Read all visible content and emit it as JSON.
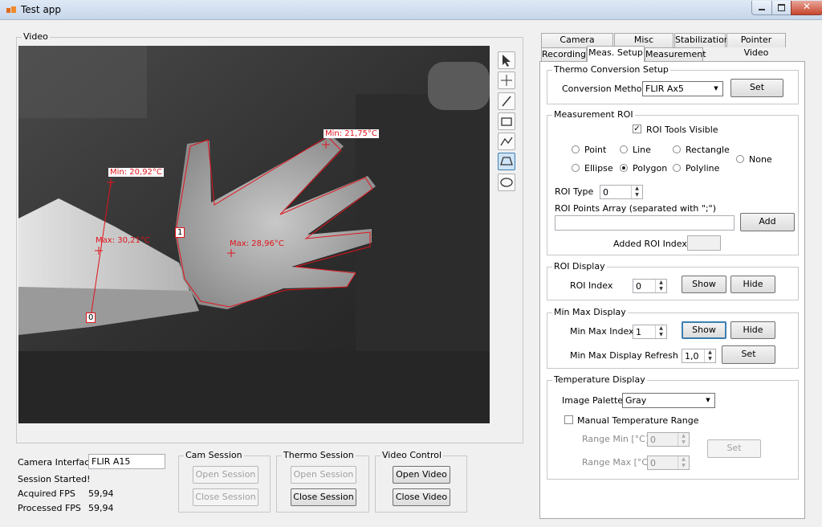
{
  "window": {
    "title": "Test app"
  },
  "video": {
    "group_label": "Video",
    "annotations": {
      "min_left": "Min: 20,92°C",
      "max_left": "Max: 30,21°C",
      "min_top": "Min: 21,75°C",
      "max_mid": "Max: 28,96°C",
      "idx0": "0",
      "idx1": "1"
    }
  },
  "tools": [
    "pointer-icon",
    "crosshair-icon",
    "line-icon",
    "rectangle-icon",
    "polyline-icon",
    "polygon-icon",
    "ellipse-icon"
  ],
  "bottom": {
    "camera_interface_label": "Camera Interface:",
    "camera_interface_value": "FLIR A15",
    "session_status": "Session Started!",
    "acquired_fps_label": "Acquired FPS",
    "acquired_fps_value": "59,94",
    "processed_fps_label": "Processed FPS",
    "processed_fps_value": "59,94",
    "cam_session": {
      "label": "Cam Session",
      "open": "Open Session",
      "close": "Close Session"
    },
    "thermo_session": {
      "label": "Thermo Session",
      "open": "Open Session",
      "close": "Close Session"
    },
    "video_control": {
      "label": "Video Control",
      "open": "Open Video",
      "close": "Close Video"
    }
  },
  "tabs": {
    "row1": [
      "Camera Attributes",
      "Misc Settings",
      "Stabilization",
      "Pointer Video"
    ],
    "row2": [
      "Recording",
      "Meas. Setup",
      "Measurement"
    ],
    "active": "Meas. Setup"
  },
  "thermo_conversion": {
    "label": "Thermo Conversion Setup",
    "method_label": "Conversion Method",
    "method_value": "FLIR Ax5",
    "set": "Set"
  },
  "measurement_roi": {
    "label": "Measurement ROI",
    "tools_visible": "ROI Tools Visible",
    "radios": {
      "point": "Point",
      "line": "Line",
      "rectangle": "Rectangle",
      "none": "None",
      "ellipse": "Ellipse",
      "polygon": "Polygon",
      "polyline": "Polyline"
    },
    "selected": "Polygon",
    "roi_type_label": "ROI Type",
    "roi_type_value": "0",
    "points_label": "ROI Points Array (separated with \";\")",
    "points_value": "",
    "add": "Add",
    "added_index_label": "Added ROI Index",
    "added_index_value": ""
  },
  "roi_display": {
    "label": "ROI Display",
    "index_label": "ROI Index",
    "index_value": "0",
    "show": "Show",
    "hide": "Hide"
  },
  "min_max_display": {
    "label": "Min Max Display",
    "index_label": "Min Max Index",
    "index_value": "1",
    "show": "Show",
    "hide": "Hide",
    "refresh_label": "Min Max Display Refresh [s]",
    "refresh_value": "1,0",
    "set": "Set"
  },
  "temperature_display": {
    "label": "Temperature Display",
    "palette_label": "Image Palette",
    "palette_value": "Gray",
    "manual_range": "Manual Temperature Range",
    "range_min_label": "Range Min [°C]",
    "range_min_value": "0",
    "range_max_label": "Range Max [°C]",
    "range_max_value": "0",
    "set": "Set"
  },
  "colors": {
    "annotation": "#e0141c",
    "accent": "#3c7fb1"
  }
}
